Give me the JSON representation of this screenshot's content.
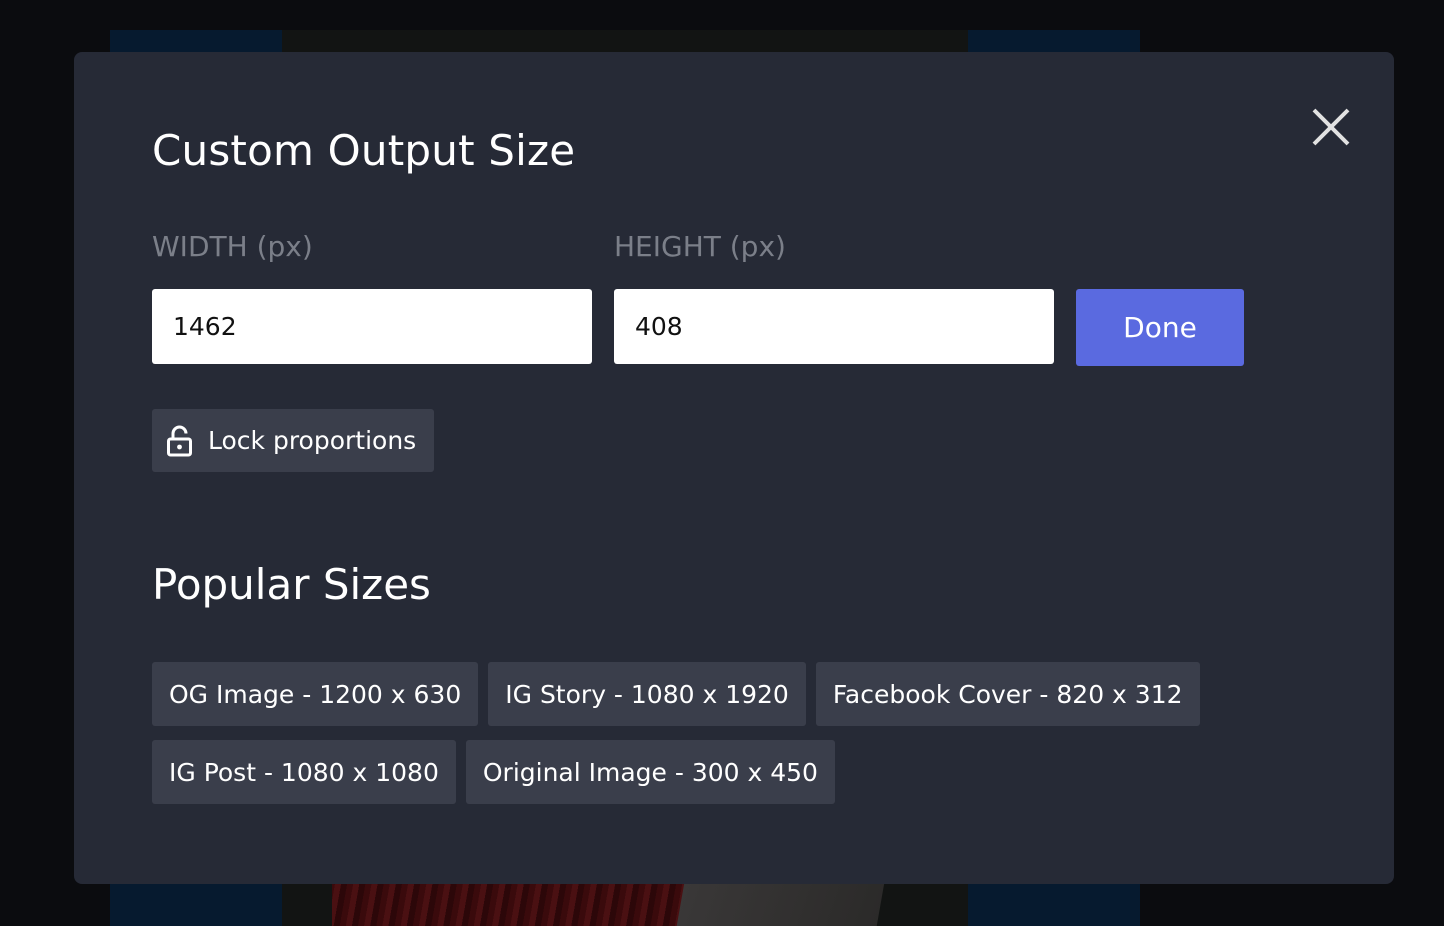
{
  "modal": {
    "title": "Custom Output Size",
    "close_icon": "close-icon",
    "width": {
      "label": "WIDTH (px)",
      "value": "1462"
    },
    "height": {
      "label": "HEIGHT (px)",
      "value": "408"
    },
    "done_label": "Done",
    "lock": {
      "label": "Lock proportions",
      "icon": "unlocked-padlock-icon",
      "locked": false
    },
    "popular": {
      "title": "Popular Sizes",
      "presets": [
        {
          "label": "OG Image - 1200 x 630"
        },
        {
          "label": "IG Story - 1080 x 1920"
        },
        {
          "label": "Facebook Cover - 820 x 312"
        },
        {
          "label": "IG Post - 1080 x 1080"
        },
        {
          "label": "Original Image - 300 x 450"
        }
      ]
    }
  },
  "colors": {
    "accent": "#5a6ae0",
    "modal_bg": "#262a36",
    "chip_bg": "#3a3e4b",
    "label": "#7b7f89",
    "page_bg": "#0b0c0f"
  }
}
